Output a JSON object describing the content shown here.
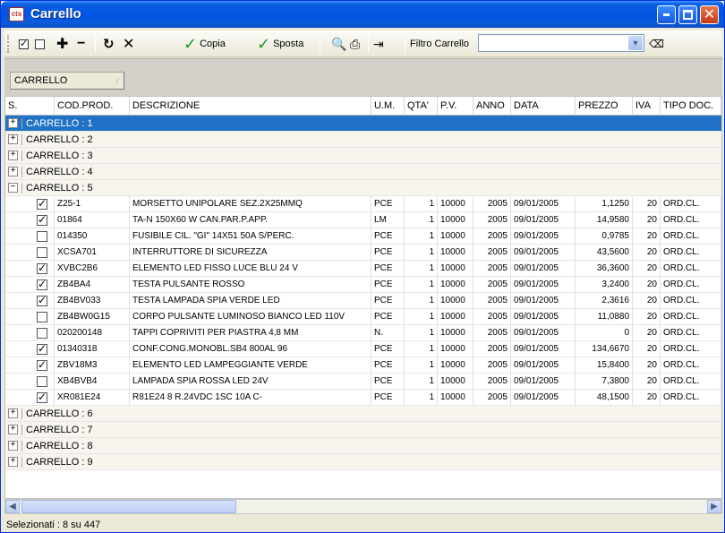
{
  "window": {
    "title": "Carrello",
    "icon_text": "cts"
  },
  "toolbar": {
    "copy_label": "Copia",
    "move_label": "Sposta",
    "filter_label": "Filtro Carrello",
    "filter_value": ""
  },
  "grouping": {
    "field": "CARRELLO"
  },
  "columns": [
    "S.",
    "COD.PROD.",
    "DESCRIZIONE",
    "U.M.",
    "QTA'",
    "P.V.",
    "ANNO",
    "DATA",
    "PREZZO",
    "IVA",
    "TIPO DOC."
  ],
  "groups_before": [
    {
      "label": "CARRELLO : 1",
      "selected": true,
      "sign": "+"
    },
    {
      "label": "CARRELLO : 2",
      "selected": false,
      "sign": "+"
    },
    {
      "label": "CARRELLO : 3",
      "selected": false,
      "sign": "+"
    },
    {
      "label": "CARRELLO : 4",
      "selected": false,
      "sign": "+"
    },
    {
      "label": "CARRELLO : 5",
      "selected": false,
      "sign": "−"
    }
  ],
  "items": [
    {
      "checked": true,
      "cod": "Z25-1",
      "desc": "MORSETTO UNIPOLARE SEZ.2X25MMQ",
      "um": "PCE",
      "qta": "1",
      "pv": "10000",
      "anno": "2005",
      "data": "09/01/2005",
      "prezzo": "1,1250",
      "iva": "20",
      "tipo": "ORD.CL."
    },
    {
      "checked": true,
      "cod": "01864",
      "desc": "TA-N 150X60 W CAN.PAR.P.APP.",
      "um": "LM",
      "qta": "1",
      "pv": "10000",
      "anno": "2005",
      "data": "09/01/2005",
      "prezzo": "14,9580",
      "iva": "20",
      "tipo": "ORD.CL."
    },
    {
      "checked": false,
      "cod": "014350",
      "desc": "FUSIBILE CIL. \"GI\" 14X51 50A S/PERC.",
      "um": "PCE",
      "qta": "1",
      "pv": "10000",
      "anno": "2005",
      "data": "09/01/2005",
      "prezzo": "0,9785",
      "iva": "20",
      "tipo": "ORD.CL."
    },
    {
      "checked": false,
      "cod": "XCSA701",
      "desc": "INTERRUTTORE DI SICUREZZA",
      "um": "PCE",
      "qta": "1",
      "pv": "10000",
      "anno": "2005",
      "data": "09/01/2005",
      "prezzo": "43,5600",
      "iva": "20",
      "tipo": "ORD.CL."
    },
    {
      "checked": true,
      "cod": "XVBC2B6",
      "desc": "ELEMENTO LED FISSO LUCE BLU 24 V",
      "um": "PCE",
      "qta": "1",
      "pv": "10000",
      "anno": "2005",
      "data": "09/01/2005",
      "prezzo": "36,3600",
      "iva": "20",
      "tipo": "ORD.CL."
    },
    {
      "checked": true,
      "cod": "ZB4BA4",
      "desc": "TESTA PULSANTE ROSSO",
      "um": "PCE",
      "qta": "1",
      "pv": "10000",
      "anno": "2005",
      "data": "09/01/2005",
      "prezzo": "3,2400",
      "iva": "20",
      "tipo": "ORD.CL."
    },
    {
      "checked": true,
      "cod": "ZB4BV033",
      "desc": "TESTA LAMPADA SPIA VERDE LED",
      "um": "PCE",
      "qta": "1",
      "pv": "10000",
      "anno": "2005",
      "data": "09/01/2005",
      "prezzo": "2,3616",
      "iva": "20",
      "tipo": "ORD.CL."
    },
    {
      "checked": false,
      "cod": "ZB4BW0G15",
      "desc": "CORPO PULSANTE LUMINOSO BIANCO LED 110V",
      "um": "PCE",
      "qta": "1",
      "pv": "10000",
      "anno": "2005",
      "data": "09/01/2005",
      "prezzo": "11,0880",
      "iva": "20",
      "tipo": "ORD.CL."
    },
    {
      "checked": false,
      "cod": "020200148",
      "desc": "TAPPI COPRIVITI PER PIASTRA 4,8 MM",
      "um": "N.",
      "qta": "1",
      "pv": "10000",
      "anno": "2005",
      "data": "09/01/2005",
      "prezzo": "0",
      "iva": "20",
      "tipo": "ORD.CL."
    },
    {
      "checked": true,
      "cod": "01340318",
      "desc": "CONF.CONG.MONOBL.SB4 800AL 96",
      "um": "PCE",
      "qta": "1",
      "pv": "10000",
      "anno": "2005",
      "data": "09/01/2005",
      "prezzo": "134,6670",
      "iva": "20",
      "tipo": "ORD.CL."
    },
    {
      "checked": true,
      "cod": "ZBV18M3",
      "desc": "ELEMENTO LED LAMPEGGIANTE VERDE",
      "um": "PCE",
      "qta": "1",
      "pv": "10000",
      "anno": "2005",
      "data": "09/01/2005",
      "prezzo": "15,8400",
      "iva": "20",
      "tipo": "ORD.CL."
    },
    {
      "checked": false,
      "cod": "XB4BVB4",
      "desc": "LAMPADA SPIA ROSSA LED 24V",
      "um": "PCE",
      "qta": "1",
      "pv": "10000",
      "anno": "2005",
      "data": "09/01/2005",
      "prezzo": "7,3800",
      "iva": "20",
      "tipo": "ORD.CL."
    },
    {
      "checked": true,
      "cod": "XR081E24",
      "desc": "R81E24        8 R.24VDC 1SC 10A C-",
      "um": "PCE",
      "qta": "1",
      "pv": "10000",
      "anno": "2005",
      "data": "09/01/2005",
      "prezzo": "48,1500",
      "iva": "20",
      "tipo": "ORD.CL."
    }
  ],
  "groups_after": [
    {
      "label": "CARRELLO : 6",
      "sign": "+"
    },
    {
      "label": "CARRELLO : 7",
      "sign": "+"
    },
    {
      "label": "CARRELLO : 8",
      "sign": "+"
    },
    {
      "label": "CARRELLO : 9",
      "sign": "+"
    }
  ],
  "status": {
    "text": "Selezionati : 8 su 447"
  },
  "colors": {
    "title_blue": "#0054e3",
    "selected_row": "#1f72c5",
    "check_green": "#1b9c1b"
  }
}
